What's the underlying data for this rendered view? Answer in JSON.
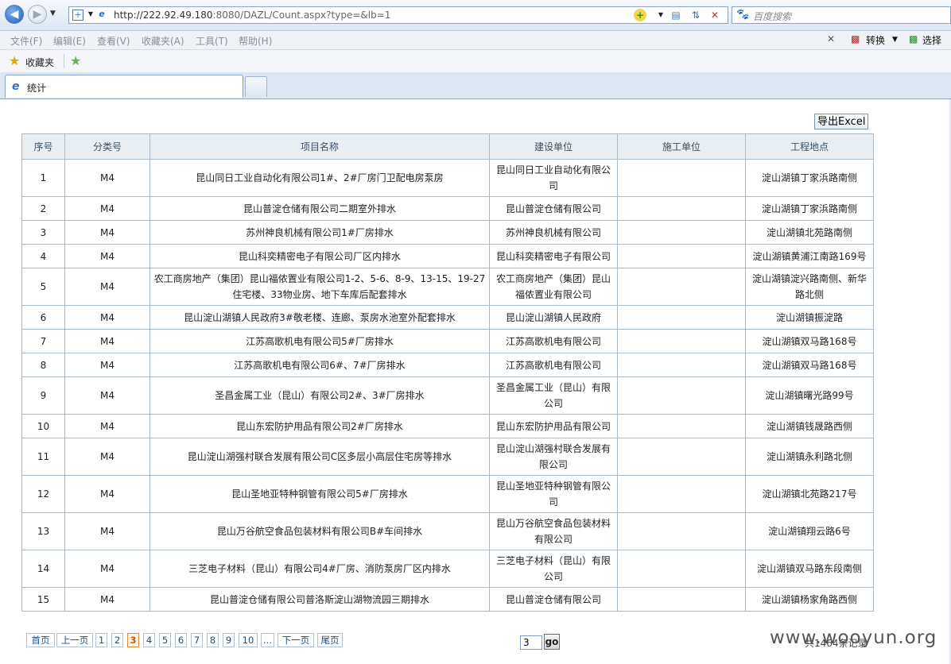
{
  "browser": {
    "url_host": "http://222.92.49.180",
    "url_path": ":8080/DAZL/Count.aspx?type=&lb=1",
    "search_placeholder": "百度搜索",
    "menu": [
      "文件(F)",
      "编辑(E)",
      "查看(V)",
      "收藏夹(A)",
      "工具(T)",
      "帮助(H)"
    ],
    "toolbar": {
      "convert_label": "转换",
      "select_label": "选择"
    },
    "favorites_label": "收藏夹",
    "tab_title": "统计"
  },
  "page": {
    "export_label": "导出Excel",
    "headers": [
      "序号",
      "分类号",
      "项目名称",
      "建设单位",
      "施工单位",
      "工程地点"
    ],
    "rows": [
      [
        "1",
        "M4",
        "昆山同日工业自动化有限公司1#、2#厂房门卫配电房泵房",
        "昆山同日工业自动化有限公司",
        "",
        "淀山湖镇丁家浜路南侧"
      ],
      [
        "2",
        "M4",
        "昆山普淀仓储有限公司二期室外排水",
        "昆山普淀仓储有限公司",
        "",
        "淀山湖镇丁家浜路南侧"
      ],
      [
        "3",
        "M4",
        "苏州神良机械有限公司1#厂房排水",
        "苏州神良机械有限公司",
        "",
        "淀山湖镇北苑路南侧"
      ],
      [
        "4",
        "M4",
        "昆山科奕精密电子有限公司厂区内排水",
        "昆山科奕精密电子有限公司",
        "",
        "淀山湖镇黄浦江南路169号"
      ],
      [
        "5",
        "M4",
        "农工商房地产（集团）昆山福侬置业有限公司1-2、5-6、8-9、13-15、19-27住宅楼、33物业房、地下车库后配套排水",
        "农工商房地产（集团）昆山福侬置业有限公司",
        "",
        "淀山湖镇淀兴路南侧、新华路北侧"
      ],
      [
        "6",
        "M4",
        "昆山淀山湖镇人民政府3#敬老楼、连廊、泵房水池室外配套排水",
        "昆山淀山湖镇人民政府",
        "",
        "淀山湖镇振淀路"
      ],
      [
        "7",
        "M4",
        "江苏高歌机电有限公司5#厂房排水",
        "江苏高歌机电有限公司",
        "",
        "淀山湖镇双马路168号"
      ],
      [
        "8",
        "M4",
        "江苏高歌机电有限公司6#、7#厂房排水",
        "江苏高歌机电有限公司",
        "",
        "淀山湖镇双马路168号"
      ],
      [
        "9",
        "M4",
        "圣昌金属工业（昆山）有限公司2#、3#厂房排水",
        "圣昌金属工业（昆山）有限公司",
        "",
        "淀山湖镇曙光路99号"
      ],
      [
        "10",
        "M4",
        "昆山东宏防护用品有限公司2#厂房排水",
        "昆山东宏防护用品有限公司",
        "",
        "淀山湖镇钱晟路西侧"
      ],
      [
        "11",
        "M4",
        "昆山淀山湖强村联合发展有限公司C区多层小高层住宅房等排水",
        "昆山淀山湖强村联合发展有限公司",
        "",
        "淀山湖镇永利路北侧"
      ],
      [
        "12",
        "M4",
        "昆山圣地亚特种钢管有限公司5#厂房排水",
        "昆山圣地亚特种钢管有限公司",
        "",
        "淀山湖镇北苑路217号"
      ],
      [
        "13",
        "M4",
        "昆山万谷航空食品包装材料有限公司B#车间排水",
        "昆山万谷航空食品包装材料有限公司",
        "",
        "淀山湖镇翔云路6号"
      ],
      [
        "14",
        "M4",
        "三芝电子材料（昆山）有限公司4#厂房、消防泵房厂区内排水",
        "三芝电子材料（昆山）有限公司",
        "",
        "淀山湖镇双马路东段南侧"
      ],
      [
        "15",
        "M4",
        "昆山普淀仓储有限公司普洛斯淀山湖物流园三期排水",
        "昆山普淀仓储有限公司",
        "",
        "淀山湖镇杨家角路西侧"
      ]
    ],
    "pager": {
      "first": "首页",
      "prev": "上一页",
      "pages": [
        "1",
        "2",
        "3",
        "4",
        "5",
        "6",
        "7",
        "8",
        "9",
        "10",
        "..."
      ],
      "current": "3",
      "next": "下一页",
      "last": "尾页",
      "goto_value": "3",
      "go_label": "go",
      "total_text": "共1464条记录"
    }
  },
  "watermark": "www.wooyun.org"
}
